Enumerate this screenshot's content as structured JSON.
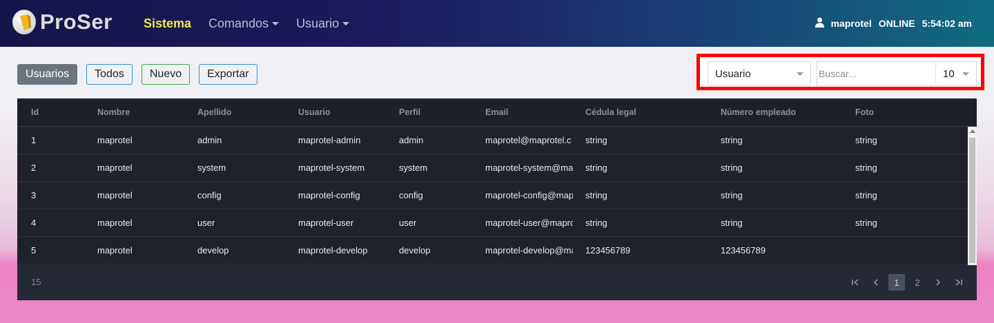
{
  "brand": {
    "name": "ProSer"
  },
  "nav": {
    "items": [
      {
        "label": "Sistema",
        "active": true
      },
      {
        "label": "Comandos",
        "dropdown": true
      },
      {
        "label": "Usuario",
        "dropdown": true
      }
    ],
    "user": {
      "icon": "user-icon",
      "name": "maprotel",
      "status": "ONLINE",
      "time": "5:54:02 am"
    }
  },
  "toolbar": {
    "usuarios_label": "Usuarios",
    "todos_label": "Todos",
    "nuevo_label": "Nuevo",
    "exportar_label": "Exportar"
  },
  "search": {
    "field_value": "Usuario",
    "placeholder": "Buscar...",
    "page_size": "10",
    "highlight_color": "#ff0000"
  },
  "table": {
    "columns": [
      "Id",
      "Nombre",
      "Apellido",
      "Usuario",
      "Perfil",
      "Email",
      "Cédula legal",
      "Número empleado",
      "Foto"
    ],
    "rows": [
      [
        "1",
        "maprotel",
        "admin",
        "maprotel-admin",
        "admin",
        "maprotel@maprotel.c",
        "string",
        "string",
        "string"
      ],
      [
        "2",
        "maprotel",
        "system",
        "maprotel-system",
        "system",
        "maprotel-system@ma",
        "string",
        "string",
        "string"
      ],
      [
        "3",
        "maprotel",
        "config",
        "maprotel-config",
        "config",
        "maprotel-config@map",
        "string",
        "string",
        "string"
      ],
      [
        "4",
        "maprotel",
        "user",
        "maprotel-user",
        "user",
        "maprotel-user@mapro",
        "string",
        "string",
        "string"
      ],
      [
        "5",
        "maprotel",
        "develop",
        "maprotel-develop",
        "develop",
        "maprotel-develop@ma",
        "123456789",
        "123456789",
        ""
      ]
    ],
    "total": "15",
    "pages": [
      "1",
      "2"
    ],
    "current_page": "1"
  },
  "colors": {
    "navbar_start": "#13154a",
    "navbar_end": "#0f6c80",
    "active_nav": "#f4e64a",
    "table_bg": "#1f222a"
  }
}
